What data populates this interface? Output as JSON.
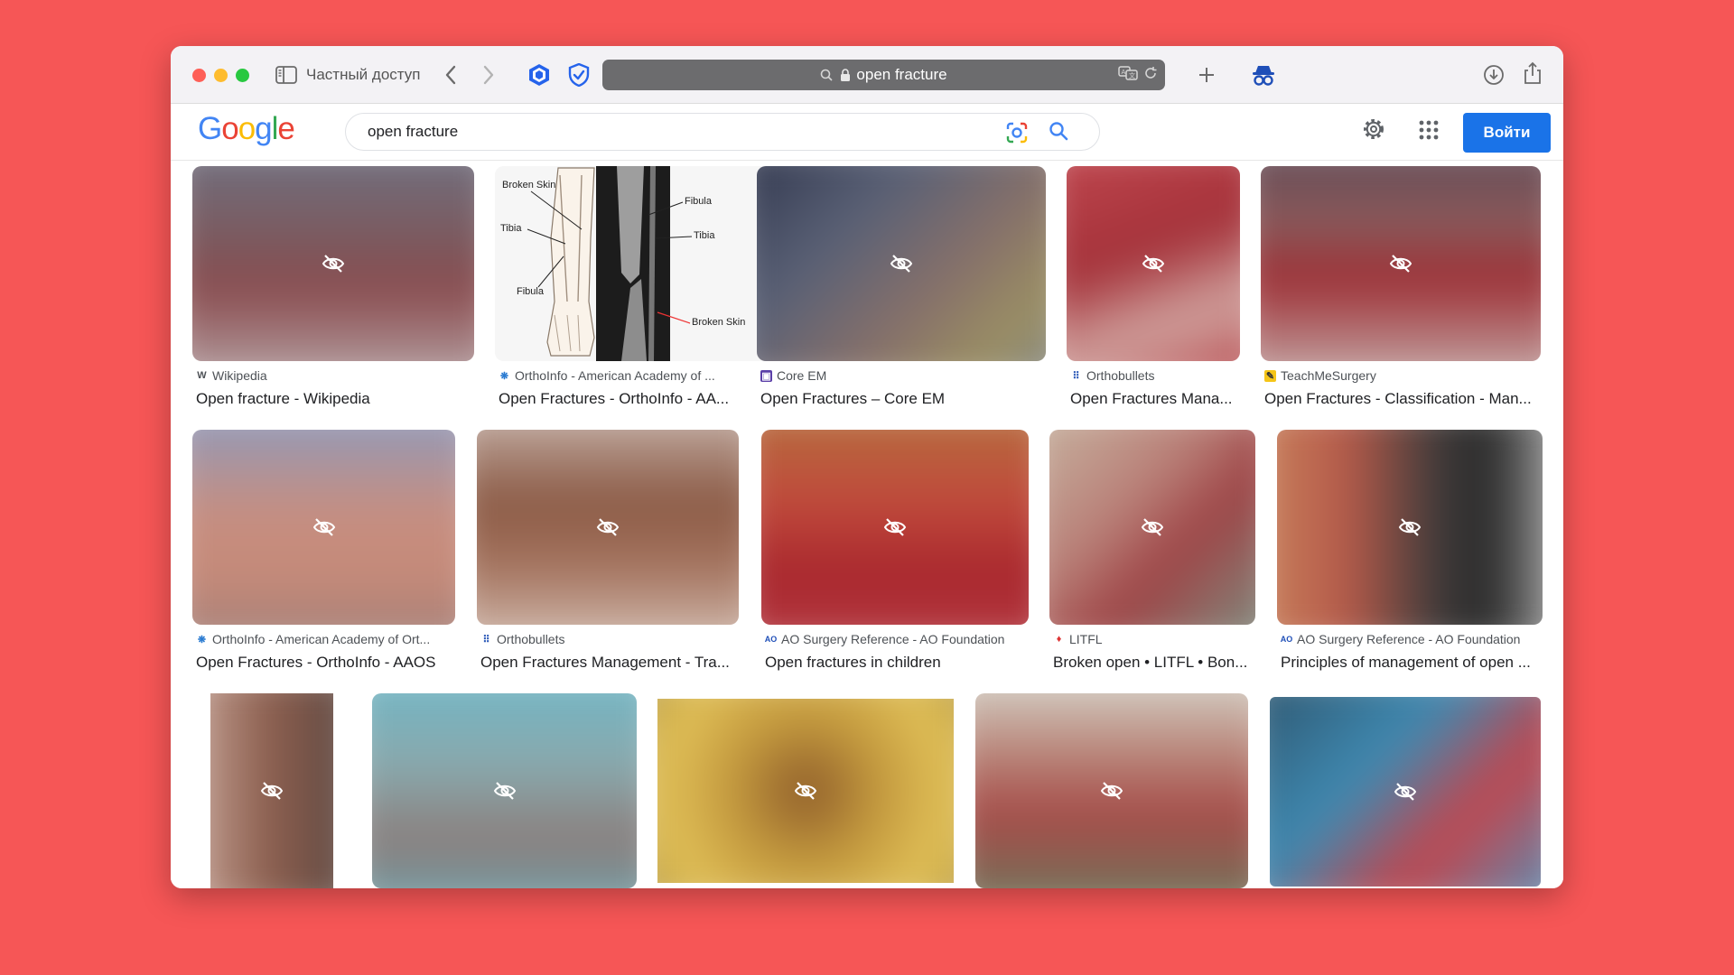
{
  "browser": {
    "private_label": "Частный доступ",
    "url": "open fracture"
  },
  "google": {
    "logo": [
      "G",
      "o",
      "o",
      "g",
      "l",
      "e"
    ],
    "logo_colors": [
      "#4285f4",
      "#ea4335",
      "#fbbc05",
      "#4285f4",
      "#34a853",
      "#ea4335"
    ],
    "search_query": "open fracture",
    "signin_label": "Войти"
  },
  "results": {
    "row1": [
      {
        "source": "Wikipedia",
        "title": "Open fracture - Wikipedia",
        "favicon": "W"
      },
      {
        "source": "OrthoInfo - American Academy of ...",
        "title": "Open Fractures - OrthoInfo - AA...",
        "favicon": "❋"
      },
      {
        "source": "Core EM",
        "title": "Open Fractures – Core EM",
        "favicon": "▣"
      },
      {
        "source": "Orthobullets",
        "title": "Open Fractures Mana...",
        "favicon": "⠿"
      },
      {
        "source": "TeachMeSurgery",
        "title": "Open Fractures - Classification - Man...",
        "favicon": "✎"
      }
    ],
    "row2": [
      {
        "source": "OrthoInfo - American Academy of Ort...",
        "title": "Open Fractures - OrthoInfo - AAOS",
        "favicon": "❋"
      },
      {
        "source": "Orthobullets",
        "title": "Open Fractures Management - Tra...",
        "favicon": "⠿"
      },
      {
        "source": "AO Surgery Reference - AO Foundation",
        "title": "Open fractures in children",
        "favicon": "AO"
      },
      {
        "source": "LITFL",
        "title": "Broken open • LITFL • Bon...",
        "favicon": "♦"
      },
      {
        "source": "AO Surgery Reference - AO Foundation",
        "title": "Principles of management of open ...",
        "favicon": "AO"
      }
    ],
    "diagram_labels": {
      "broken_skin_left": "Broken Skin",
      "tibia_left": "Tibia",
      "fibula_left": "Fibula",
      "fibula_right": "Fibula",
      "tibia_right": "Tibia",
      "broken_skin_right": "Broken Skin"
    }
  },
  "colors": {
    "background": "#f65656",
    "accent": "#1a73e8"
  }
}
